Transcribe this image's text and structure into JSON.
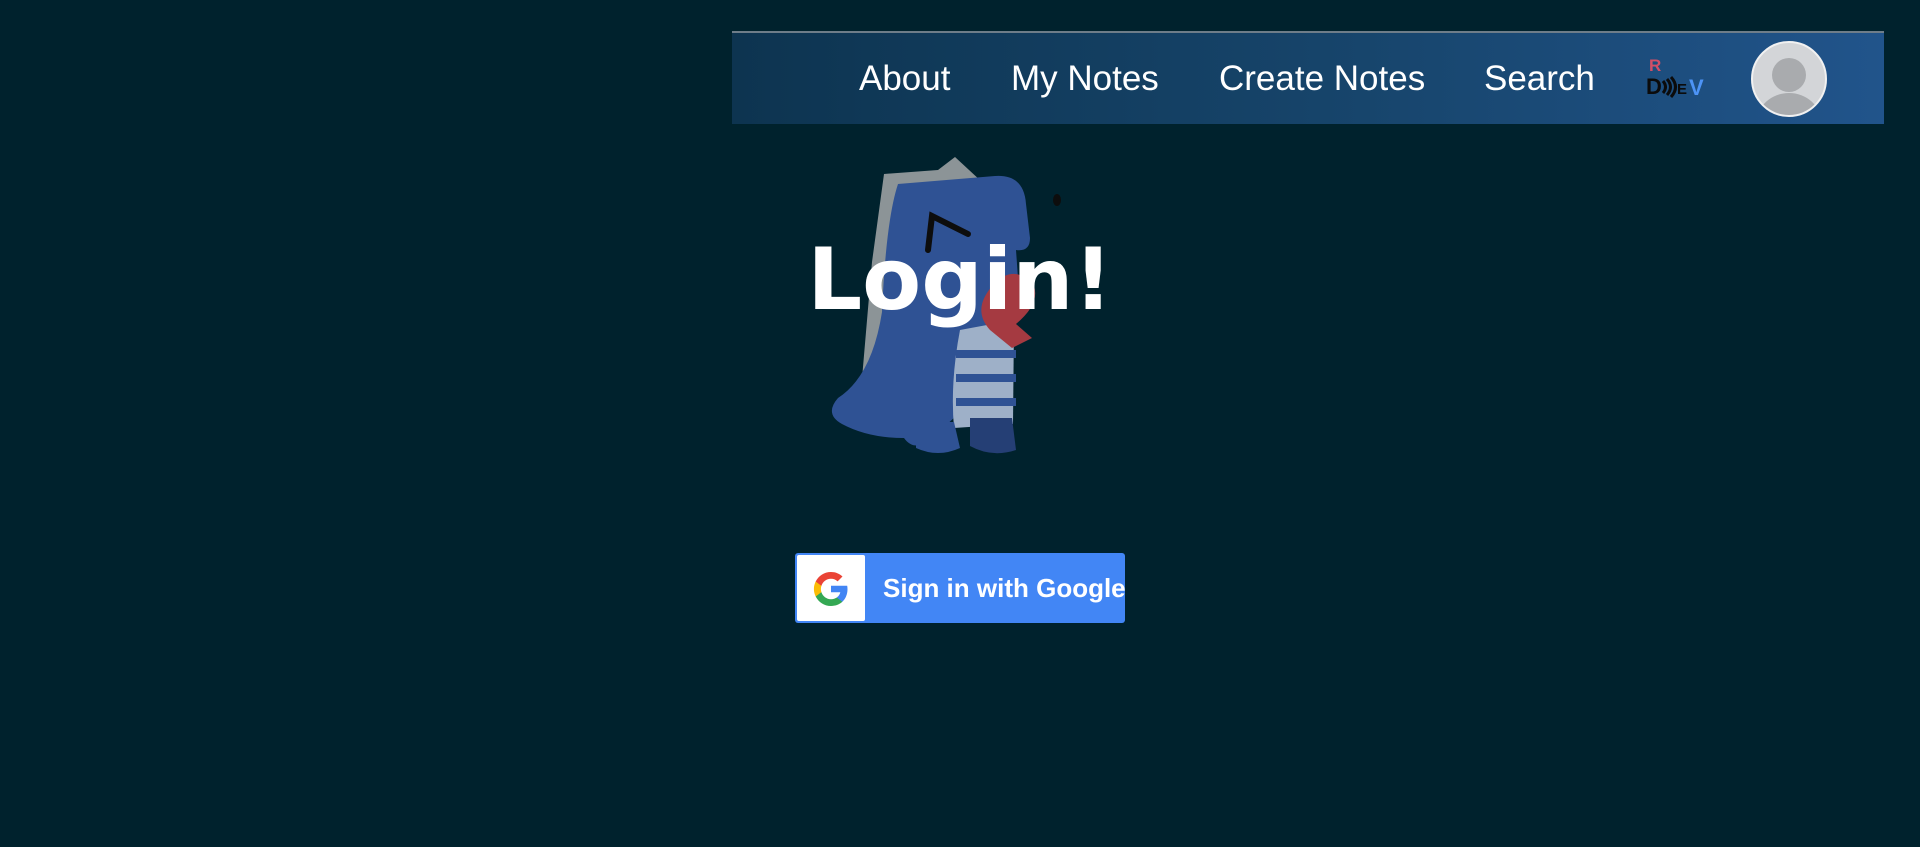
{
  "nav": {
    "links": [
      "About",
      "My Notes",
      "Create Notes",
      "Search"
    ],
    "logo": {
      "name": "rdev-logo-icon",
      "text": "RD)))EV"
    },
    "avatar": "default-user-avatar-icon"
  },
  "main": {
    "title": "Login!",
    "hero_image": "dinosaur-illustration-icon"
  },
  "google_signin": {
    "label": "Sign in with Google",
    "icon": "google-g-icon"
  },
  "colors": {
    "background": "#00222d",
    "navbar_start": "#0d3450",
    "navbar_end": "#21548b",
    "google_blue": "#4286f5"
  }
}
